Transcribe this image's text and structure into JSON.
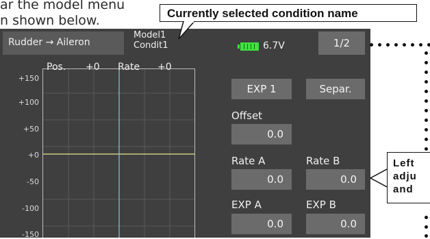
{
  "doc": {
    "line1": "ar the model menu",
    "line2": "n shown below."
  },
  "callouts": {
    "top": "Currently selected condition name",
    "right_lines": [
      "Left",
      "adju",
      "and"
    ]
  },
  "screen": {
    "function_name": "Rudder → Aileron",
    "model_name": "Model1",
    "condition_name": "Condit1",
    "battery_voltage": "6.7V",
    "page_indicator": "1/2",
    "graph": {
      "pos_label": "Pos.",
      "pos_value": "+0",
      "rate_label": "Rate",
      "rate_value": "+0",
      "y_ticks": [
        "+150",
        "+100",
        "+50",
        "+0",
        "-50",
        "-100",
        "-150"
      ]
    },
    "exp_button": "EXP 1",
    "separate_button": "Separ.",
    "offset_label": "Offset",
    "offset_value": "0.0",
    "rate_a_label": "Rate A",
    "rate_a_value": "0.0",
    "rate_b_label": "Rate B",
    "rate_b_value": "0.0",
    "exp_a_label": "EXP A",
    "exp_a_value": "0.0",
    "exp_b_label": "EXP B",
    "exp_b_value": "0.0"
  },
  "colors": {
    "screen_bg": "#3f3f3f",
    "box_bg": "#6b6b6b",
    "battery": "#3fe23f",
    "curve": "#e8e890",
    "cursor": "#7ec8e8"
  }
}
